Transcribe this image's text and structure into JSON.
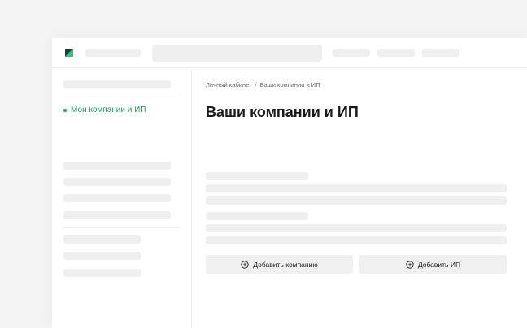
{
  "header": {
    "logo": "company-logo"
  },
  "sidebar": {
    "active_item": {
      "label": "Мои компании и ИП"
    }
  },
  "main": {
    "breadcrumb": {
      "items": [
        "Личный кабинет",
        "Ваши компании и ИП"
      ],
      "separator": "/"
    },
    "title": "Ваши компании и ИП",
    "buttons": {
      "add_company": "Добавить компанию",
      "add_ip": "Добавить ИП",
      "icon": "plus-circle-icon"
    }
  },
  "colors": {
    "accent": "#1a9f5c",
    "logo_dark": "#1f3a3a",
    "skeleton": "#efefef"
  }
}
